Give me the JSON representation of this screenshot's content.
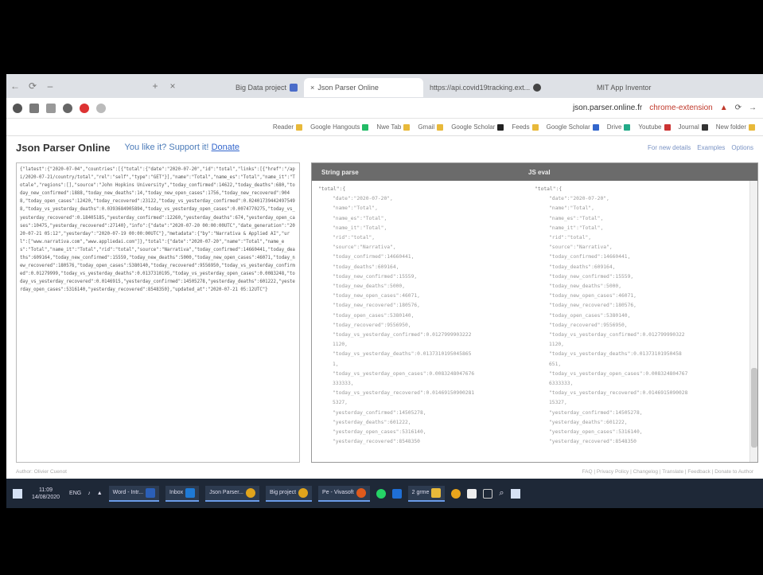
{
  "browser": {
    "nav": [
      "←",
      "⟳",
      "–"
    ],
    "new_tab": "+",
    "close": "×",
    "tabs": [
      {
        "label": "Big Data project"
      },
      {
        "label": "Json Parser Online"
      },
      {
        "label": "https://api.covid19tracking.ext..."
      },
      {
        "label": "MIT App Inventor"
      }
    ],
    "address": "json.parser.online.fr",
    "extension_label": "chrome-extension",
    "bookmarks": [
      "Reader",
      "Google Hangouts",
      "Nwe Tab",
      "Gmail",
      "Google Scholar",
      "Feeds",
      "Google Scholar",
      "Drive",
      "Youtube",
      "Journal",
      "New folder"
    ]
  },
  "page": {
    "title": "Json Parser Online",
    "support_text": "You like it? Support it!",
    "donate_link": "Donate",
    "header_links": [
      "For new details",
      "Examples",
      "Options"
    ]
  },
  "editor": {
    "raw_json": "{\"latest\":{\"2020-07-04\",\"countries\":[{\"total\":{\"date\":\"2020-07-20\",\"id\":\"total\",\"links\":[{\"href\":\"/api/2020-07-21/country/total\",\"rel\":\"self\",\"type\":\"GET\"}],\"name\":\"Total\",\"name_es\":\"Total\",\"name_it\":\"Totale\",\"regions\":[],\"source\":\"John Hopkins University\",\"today_confirmed\":14622,\"today_deaths\":680,\"today_new_confirmed\":1888,\"today_new_deaths\":14,\"today_new_open_cases\":1756,\"today_new_recovered\":9048,\"today_open_cases\":12420,\"today_recovered\":23122,\"today_vs_yesterday_confirmed\":0.024017394424975498,\"today_vs_yesterday_deaths\":0.0393684905894,\"today_vs_yesterday_open_cases\":0.0074770275,\"today_vs_yesterday_recovered\":0.18405185,\"yesterday_confirmed\":12260,\"yesterday_deaths\":674,\"yesterday_open_cases\":10475,\"yesterday_recovered\":27140},\"info\":{\"date\":\"2020-07-20 00:00:00UTC\",\"date_generation\":\"2020-07-21 05:12\",\"yesterday\":\"2020-07-19 00:00:00UTC\"},\"metadata\":{\"by\":\"Narrativa & Applied AI\",\"url\":[\"www.narrativa.com\",\"www.appliedai.com\"]},\"total\":{\"date\":\"2020-07-20\",\"name\":\"Total\",\"name_es\":\"Total\",\"name_it\":\"Total\",\"rid\":\"total\",\"source\":\"Narrativa\",\"today_confirmed\":14660441,\"today_deaths\":609164,\"today_new_confirmed\":15559,\"today_new_deaths\":5000,\"today_new_open_cases\":46071,\"today_new_recovered\":180576,\"today_open_cases\":5380140,\"today_recovered\":9556950,\"today_vs_yesterday_confirmed\":0.01279999,\"today_vs_yesterday_deaths\":0.0137310195,\"today_vs_yesterday_open_cases\":0.0083248,\"today_vs_yesterday_recovered\":0.0146915,\"yesterday_confirmed\":14505278,\"yesterday_deaths\":601222,\"yesterday_open_cases\":5316140,\"yesterday_recovered\":8548350},\"updated_at\":\"2020-07-21 05:12UTC\"}"
  },
  "viewer": {
    "col1_header": "String parse",
    "col2_header": "JS eval",
    "col1_lines": [
      "\"total\":{",
      "\"date\":\"2020-07-20\",",
      "\"name\":\"Total\",",
      "\"name_es\":\"Total\",",
      "\"name_it\":\"Total\",",
      "\"rid\":\"total\",",
      "\"source\":\"Narrativa\",",
      "\"today_confirmed\":14660441,",
      "\"today_deaths\":609164,",
      "\"today_new_confirmed\":15559,",
      "\"today_new_deaths\":5000,",
      "\"today_new_open_cases\":46071,",
      "\"today_new_recovered\":180576,",
      "\"today_open_cases\":5380140,",
      "\"today_recovered\":9556950,",
      "\"today_vs_yesterday_confirmed\":0.0127999903222",
      "1120,",
      "\"today_vs_yesterday_deaths\":0.0137310195045865",
      "1,",
      "\"today_vs_yesterday_open_cases\":0.0083248047676",
      "333333,",
      "\"today_vs_yesterday_recovered\":0.01469150900281",
      "5327,",
      "\"yesterday_confirmed\":14505278,",
      "\"yesterday_deaths\":601222,",
      "\"yesterday_open_cases\":5316140,",
      "\"yesterday_recovered\":8548350"
    ],
    "col2_lines": [
      "\"total\":{",
      "\"date\":\"2020-07-20\",",
      "\"name\":\"Total\",",
      "\"name_es\":\"Total\",",
      "\"name_it\":\"Total\",",
      "\"rid\":\"total\",",
      "\"source\":\"Narrativa\",",
      "\"today_confirmed\":14660441,",
      "\"today_deaths\":609164,",
      "\"today_new_confirmed\":15559,",
      "\"today_new_deaths\":5000,",
      "\"today_new_open_cases\":46071,",
      "\"today_new_recovered\":180576,",
      "\"today_open_cases\":5380140,",
      "\"today_recovered\":9556950,",
      "\"today_vs_yesterday_confirmed\":0.012799990322",
      "1120,",
      "\"today_vs_yesterday_deaths\":0.01373101950458",
      "651,",
      "\"today_vs_yesterday_open_cases\":0.008324804767",
      "6333333,",
      "\"today_vs_yesterday_recovered\":0.0146915090028",
      "15327,",
      "\"yesterday_confirmed\":14505278,",
      "\"yesterday_deaths\":601222,",
      "\"yesterday_open_cases\":5316140,",
      "\"yesterday_recovered\":8548350"
    ]
  },
  "footer": {
    "left": "Author: Olivier Cuenot",
    "right": "FAQ | Privacy Policy | Changelog | Translate | Feedback | Donate to Author"
  },
  "taskbar": {
    "time": "11:09",
    "date": "14/08/2020",
    "lang": "ENG",
    "items": [
      "Word - Intr...",
      "Inbox",
      "Json Parser...",
      "Big project",
      "Pe - Vivasoft",
      "2 grme"
    ]
  },
  "colors": {
    "accent": "#4a7ab8",
    "viewer_header": "#6b6b6b",
    "taskbar": "#1e2837"
  }
}
